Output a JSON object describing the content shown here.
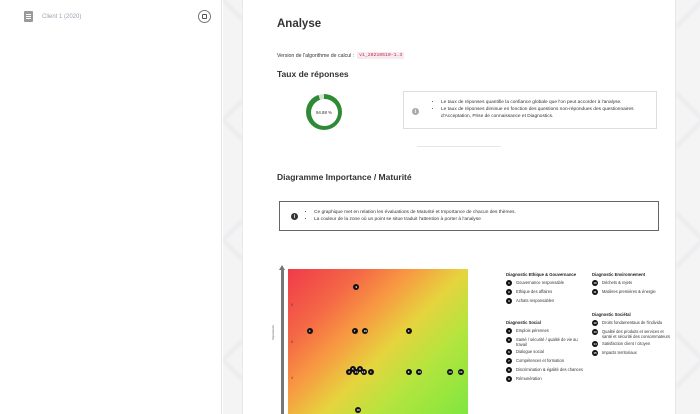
{
  "sidebar": {
    "client_label": "Client 1 (2020)"
  },
  "page": {
    "title": "Analyse",
    "algo_label": "Version de l'algorithme de calcul :",
    "algo_version": "v1_20210510-1.3",
    "response_rate_heading": "Taux de réponses",
    "response_rate_value": "94.88 %",
    "response_rate_fraction": 0.9488,
    "response_info": [
      "Le taux de réponses quantifie la confiance globale que l'on peut accorder à l'analyse.",
      "Le taux de réponses diminue en fonction des questions non-répondues des questionnaires d'Acceptation, Prise de connaissance et Diagnostics."
    ],
    "diagram_heading": "Diagramme Importance / Maturité",
    "diagram_info": [
      "Ce graphique met en relation les évaluations de Maturité et Importance de chacun des thèmes.",
      "La couleur de la zone où un point se situe traduit l'attention à porter à l'analyse"
    ],
    "info_icon": "i",
    "colors": {
      "donut": "#2e8a35",
      "code_text": "#c7254e"
    }
  },
  "chart_data": {
    "type": "scatter",
    "ylabel": "Importance",
    "y_ticks": [
      "8",
      "6",
      "4"
    ],
    "points": [
      {
        "label": "9",
        "x": 0.38,
        "y": 9
      },
      {
        "label": "4",
        "x": 0.12,
        "y": 6.6
      },
      {
        "label": "7",
        "x": 0.37,
        "y": 6.6
      },
      {
        "label": "10",
        "x": 0.43,
        "y": 6.6
      },
      {
        "label": "3",
        "x": 0.67,
        "y": 6.6
      },
      {
        "label": "5",
        "x": 0.36,
        "y": 4.5
      },
      {
        "label": "6",
        "x": 0.4,
        "y": 4.5
      },
      {
        "label": "2",
        "x": 0.34,
        "y": 4.3
      },
      {
        "label": "11",
        "x": 0.38,
        "y": 4.3
      },
      {
        "label": "12",
        "x": 0.42,
        "y": 4.3
      },
      {
        "label": "1",
        "x": 0.46,
        "y": 4.3
      },
      {
        "label": "8",
        "x": 0.67,
        "y": 4.3
      },
      {
        "label": "15",
        "x": 0.73,
        "y": 4.3
      },
      {
        "label": "13",
        "x": 0.9,
        "y": 4.3
      },
      {
        "label": "14",
        "x": 0.96,
        "y": 4.3
      },
      {
        "label": "16",
        "x": 0.39,
        "y": 2.2
      }
    ]
  },
  "legend": {
    "groups": [
      {
        "title": "Diagnostic Ethique & Gouvernance",
        "items": [
          {
            "n": "1",
            "t": "Gouvernance responsable"
          },
          {
            "n": "2",
            "t": "Ethique des affaires"
          },
          {
            "n": "3",
            "t": "Achats responsables"
          }
        ]
      },
      {
        "title": "Diagnostic Social",
        "items": [
          {
            "n": "4",
            "t": "Emplois pérennes"
          },
          {
            "n": "5",
            "t": "Santé / sécurité / qualité de vie au travail"
          },
          {
            "n": "6",
            "t": "Dialogue social"
          },
          {
            "n": "7",
            "t": "Compétences et formation"
          },
          {
            "n": "8",
            "t": "Discrimination & égalité des chances"
          },
          {
            "n": "9",
            "t": "Rémunération"
          }
        ]
      },
      {
        "title": "Diagnostic Environnement",
        "items": [
          {
            "n": "10",
            "t": "Déchets & rejets"
          },
          {
            "n": "11",
            "t": "Matières premières & énergie"
          }
        ]
      },
      {
        "title": "Diagnostic Sociétal",
        "items": [
          {
            "n": "12",
            "t": "Droits fondamentaux de l'individu"
          },
          {
            "n": "13",
            "t": "Qualité des produits et services et santé et sécurité des consommateurs"
          },
          {
            "n": "14",
            "t": "Satisfaction client / citoyen"
          },
          {
            "n": "15",
            "t": "Impacts territoriaux"
          }
        ]
      }
    ]
  }
}
